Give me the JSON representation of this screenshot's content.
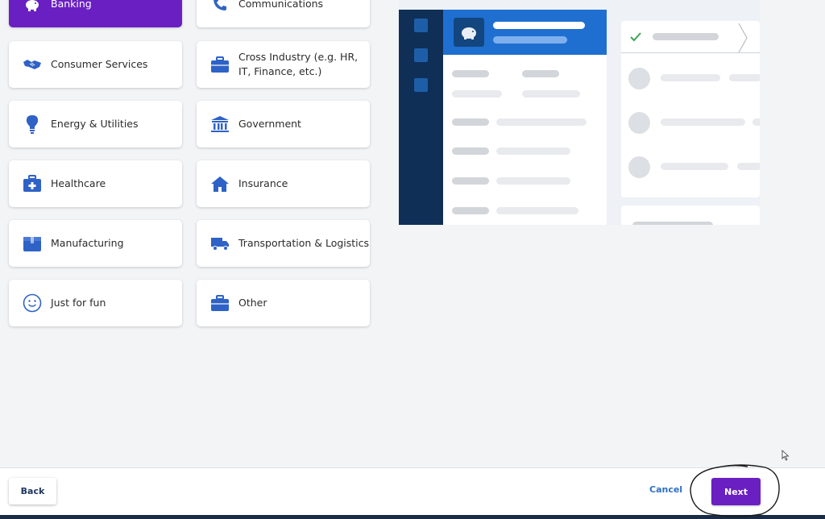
{
  "industries": [
    {
      "label": "Banking",
      "icon": "piggy-bank-icon",
      "selected": true
    },
    {
      "label": "Communications",
      "icon": "phone-icon",
      "selected": false
    },
    {
      "label": "Consumer Services",
      "icon": "handshake-icon",
      "selected": false
    },
    {
      "label": "Cross Industry (e.g. HR, IT, Finance, etc.)",
      "icon": "briefcase-icon",
      "selected": false
    },
    {
      "label": "Energy & Utilities",
      "icon": "lightbulb-icon",
      "selected": false
    },
    {
      "label": "Government",
      "icon": "government-building-icon",
      "selected": false
    },
    {
      "label": "Healthcare",
      "icon": "medical-kit-icon",
      "selected": false
    },
    {
      "label": "Insurance",
      "icon": "house-icon",
      "selected": false
    },
    {
      "label": "Manufacturing",
      "icon": "box-icon",
      "selected": false
    },
    {
      "label": "Transportation & Logistics",
      "icon": "truck-icon",
      "selected": false
    },
    {
      "label": "Just for fun",
      "icon": "smiley-icon",
      "selected": false
    },
    {
      "label": "Other",
      "icon": "briefcase-icon",
      "selected": false
    }
  ],
  "footer": {
    "back_label": "Back",
    "cancel_label": "Cancel",
    "next_label": "Next"
  },
  "colors": {
    "accent_purple": "#6a1fc2",
    "icon_blue": "#2f62c6",
    "preview_header_blue": "#1f6fd1",
    "preview_sidebar_navy": "#0f2f57",
    "link_blue": "#2e6fc4"
  }
}
